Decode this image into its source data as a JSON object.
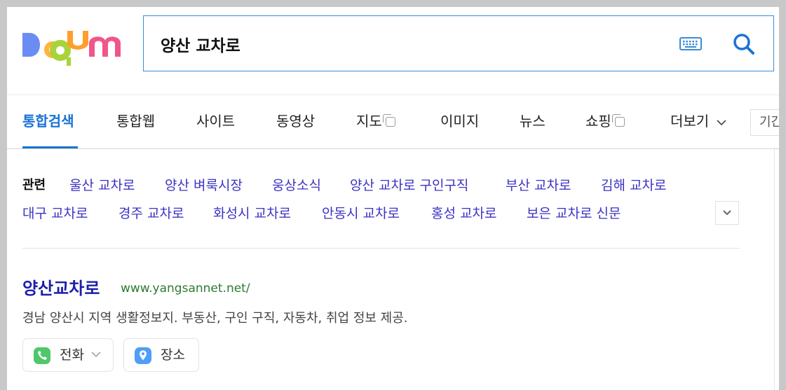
{
  "logo": {
    "text": "Daum"
  },
  "search": {
    "query": "양산 교차로",
    "keyboard_icon": "keyboard-icon",
    "search_icon": "magnifier-icon"
  },
  "tabs": [
    {
      "label": "통합검색",
      "active": true
    },
    {
      "label": "통합웹"
    },
    {
      "label": "사이트"
    },
    {
      "label": "동영상"
    },
    {
      "label": "지도",
      "external": true
    },
    {
      "label": "이미지"
    },
    {
      "label": "뉴스"
    },
    {
      "label": "쇼핑",
      "external": true
    },
    {
      "label": "더보기",
      "dropdown": true
    }
  ],
  "period": {
    "label": "기간"
  },
  "related": {
    "label": "관련",
    "items": [
      "울산 교차로",
      "양산 벼룩시장",
      "웅상소식",
      "양산 교차로 구인구직",
      "부산 교차로",
      "김해 교차로",
      "대구 교차로",
      "경주 교차로",
      "화성시 교차로",
      "안동시 교차로",
      "홍성 교차로",
      "보은 교차로 신문"
    ]
  },
  "result": {
    "title": "양산교차로",
    "url": "www.yangsannet.net/",
    "description": "경남 양산시 지역 생활정보지. 부동산, 구인 구직, 자동차, 취업 정보 제공.",
    "chips": [
      {
        "label": "전화",
        "icon": "phone-icon",
        "dropdown": true
      },
      {
        "label": "장소",
        "icon": "location-pin-icon"
      }
    ]
  },
  "colors": {
    "accent": "#1a73d6",
    "link": "#3c33c4",
    "title": "#1b1fa8",
    "url": "#2e7a2e",
    "phone_green": "#4fc76a",
    "pin_blue": "#4f9ef7"
  }
}
